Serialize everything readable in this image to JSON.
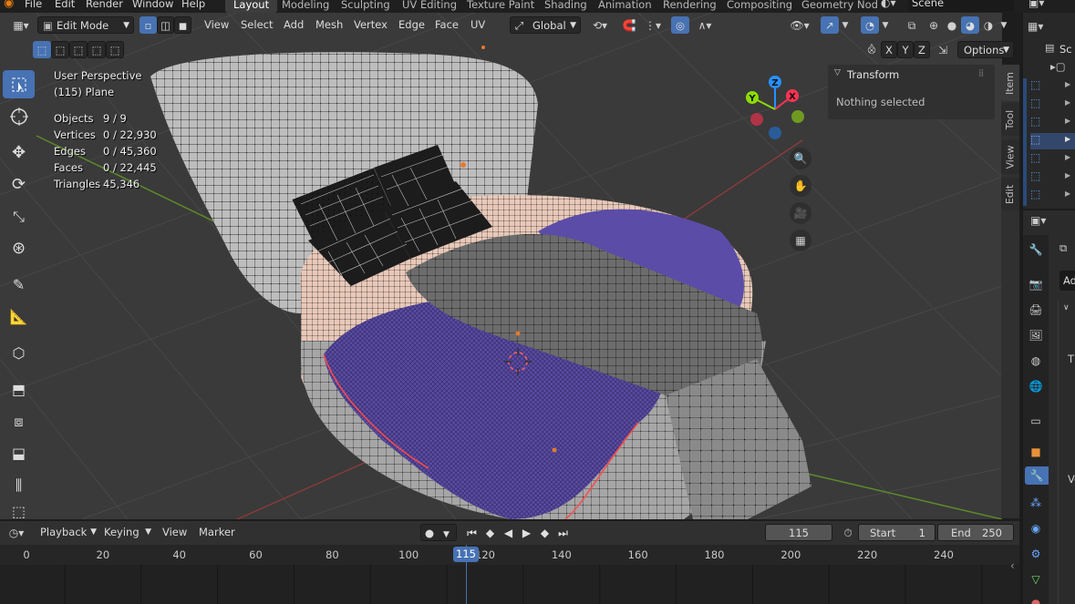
{
  "menu": [
    "File",
    "Edit",
    "Render",
    "Window",
    "Help"
  ],
  "workspaces": [
    "Layout",
    "Modeling",
    "Sculpting",
    "UV Editing",
    "Texture Paint",
    "Shading",
    "Animation",
    "Rendering",
    "Compositing",
    "Geometry Nod"
  ],
  "active_workspace": "Layout",
  "scene_name": "Scene",
  "viewport_header": {
    "mode": "Edit Mode",
    "menus": [
      "View",
      "Select",
      "Add",
      "Mesh",
      "Vertex",
      "Edge",
      "Face",
      "UV"
    ],
    "transform_orientation": "Global",
    "axes": [
      "X",
      "Y",
      "Z"
    ],
    "options": "Options"
  },
  "overlay": {
    "perspective": "User Perspective",
    "object": "(115) Plane",
    "stats": [
      {
        "label": "Objects",
        "value": "9 / 9"
      },
      {
        "label": "Vertices",
        "value": "0 / 22,930"
      },
      {
        "label": "Edges",
        "value": "0 / 45,360"
      },
      {
        "label": "Faces",
        "value": "0 / 22,445"
      },
      {
        "label": "Triangles",
        "value": "45,346"
      }
    ]
  },
  "gizmo": {
    "x": "X",
    "y": "Y",
    "z": "Z"
  },
  "npanel": {
    "section": "Transform",
    "message": "Nothing selected",
    "tabs": [
      "Item",
      "Tool",
      "View",
      "Edit"
    ]
  },
  "outliner": {
    "label": "Sc"
  },
  "properties": {
    "labels": [
      "Ad",
      "T",
      "Ve"
    ]
  },
  "timeline": {
    "menus": [
      "Playback",
      "Keying",
      "View",
      "Marker"
    ],
    "current_frame": "115",
    "start_label": "Start",
    "start": "1",
    "end_label": "End",
    "end": "250",
    "ruler": [
      "0",
      "20",
      "40",
      "60",
      "80",
      "100",
      "120",
      "140",
      "160",
      "180",
      "200",
      "220",
      "240"
    ],
    "ruler_frames": [
      0,
      20,
      40,
      60,
      80,
      100,
      120,
      140,
      160,
      180,
      200,
      220,
      240
    ]
  },
  "colors": {
    "accent": "#4772b3",
    "x_axis": "#ff3352",
    "y_axis": "#8bdc00",
    "z_axis": "#2890ff",
    "sheet": "#5b4ca8"
  }
}
